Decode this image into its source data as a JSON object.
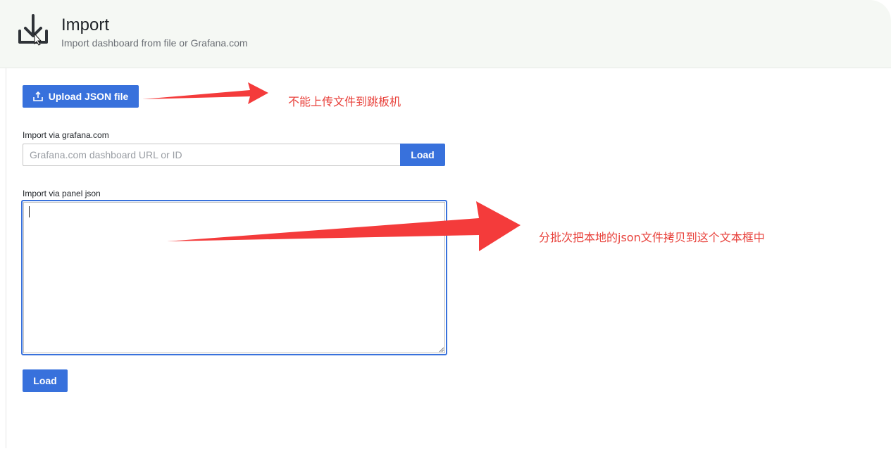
{
  "header": {
    "icon": "import-download-icon",
    "title": "Import",
    "subtitle": "Import dashboard from file or Grafana.com"
  },
  "upload": {
    "icon": "upload-icon",
    "label": "Upload JSON file"
  },
  "grafana_import": {
    "label": "Import via grafana.com",
    "placeholder": "Grafana.com dashboard URL or ID",
    "value": "",
    "load_label": "Load"
  },
  "panel_json": {
    "label": "Import via panel json",
    "value": ""
  },
  "footer": {
    "load_label": "Load"
  },
  "annotations": {
    "upload_note": "不能上传文件到跳板机",
    "json_note": "分批次把本地的json文件拷贝到这个文本框中",
    "color": "#e8413b"
  },
  "colors": {
    "primary": "#3871dc",
    "header_bg": "#f5f8f4"
  }
}
